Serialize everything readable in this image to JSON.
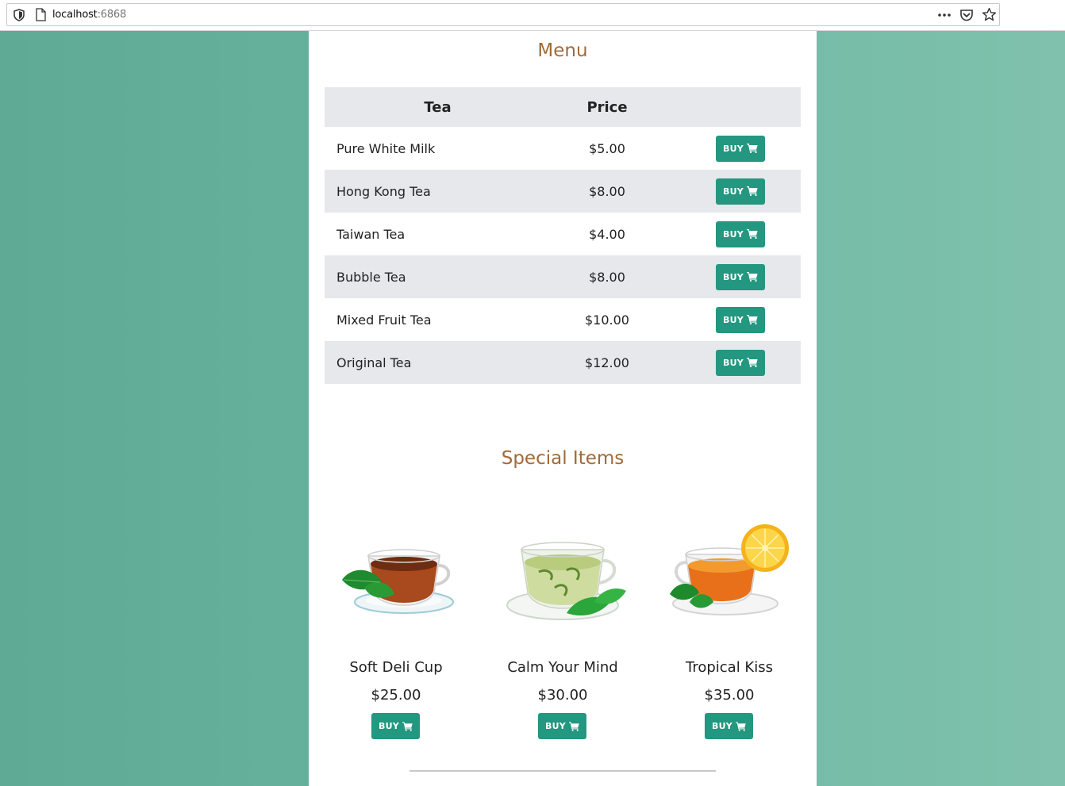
{
  "browser": {
    "url_host": "localhost",
    "url_port": ":6868"
  },
  "menu": {
    "title": "Menu",
    "headers": {
      "tea": "Tea",
      "price": "Price"
    },
    "rows": [
      {
        "name": "Pure White Milk",
        "price": "$5.00",
        "buy": "BUY"
      },
      {
        "name": "Hong Kong Tea",
        "price": "$8.00",
        "buy": "BUY"
      },
      {
        "name": "Taiwan Tea",
        "price": "$4.00",
        "buy": "BUY"
      },
      {
        "name": "Bubble Tea",
        "price": "$8.00",
        "buy": "BUY"
      },
      {
        "name": "Mixed Fruit Tea",
        "price": "$10.00",
        "buy": "BUY"
      },
      {
        "name": "Original Tea",
        "price": "$12.00",
        "buy": "BUY"
      }
    ]
  },
  "special": {
    "title": "Special Items",
    "items": [
      {
        "name": "Soft Deli Cup",
        "price": "$25.00",
        "buy": "BUY"
      },
      {
        "name": "Calm Your Mind",
        "price": "$30.00",
        "buy": "BUY"
      },
      {
        "name": "Tropical Kiss",
        "price": "$35.00",
        "buy": "BUY"
      }
    ]
  },
  "colors": {
    "accent_button": "#23977f",
    "section_title": "#a26a37",
    "row_alt": "#e6e8ec",
    "background": "#67b39d"
  },
  "icons": [
    "shield-icon",
    "page-icon",
    "more-icon",
    "pocket-icon",
    "star-icon",
    "cart-icon"
  ]
}
